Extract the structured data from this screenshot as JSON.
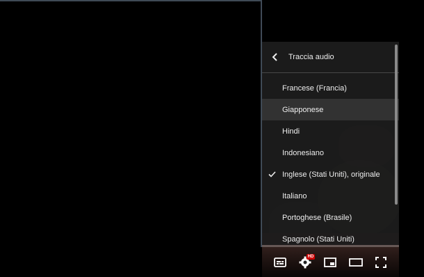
{
  "settings_menu": {
    "title": "Traccia audio",
    "items": [
      {
        "label": "Francese (Francia)",
        "selected": false,
        "highlighted": false
      },
      {
        "label": "Giapponese",
        "selected": false,
        "highlighted": true
      },
      {
        "label": "Hindi",
        "selected": false,
        "highlighted": false
      },
      {
        "label": "Indonesiano",
        "selected": false,
        "highlighted": false
      },
      {
        "label": "Inglese (Stati Uniti), originale",
        "selected": true,
        "highlighted": false
      },
      {
        "label": "Italiano",
        "selected": false,
        "highlighted": false
      },
      {
        "label": "Portoghese (Brasile)",
        "selected": false,
        "highlighted": false
      },
      {
        "label": "Spagnolo (Stati Uniti)",
        "selected": false,
        "highlighted": false
      }
    ]
  },
  "controls": {
    "settings_badge": "HD",
    "icons": [
      "subtitles-icon",
      "settings-gear-icon",
      "miniplayer-icon",
      "theater-mode-icon",
      "fullscreen-icon"
    ]
  },
  "colors": {
    "menu_bg": "#1c1c1c",
    "hd_badge": "#cc0000"
  }
}
